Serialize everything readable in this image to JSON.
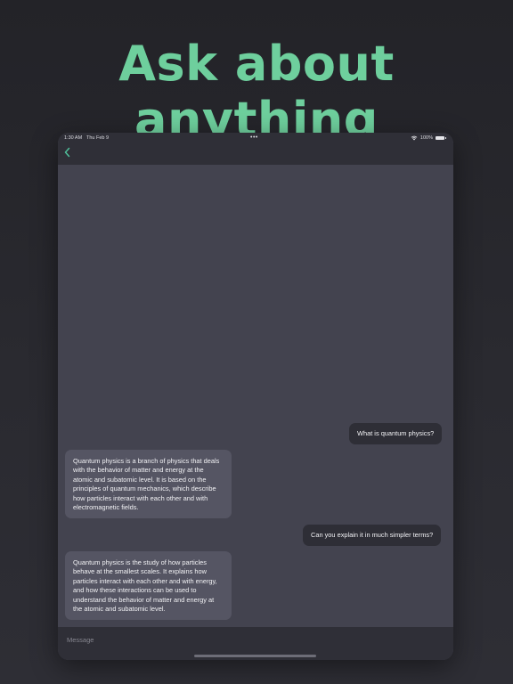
{
  "headline": "Ask about anything",
  "status_bar": {
    "time": "1:30 AM",
    "date": "Thu Feb 9",
    "dots": "•••",
    "battery": "100%",
    "wifi_icon": "wifi-icon",
    "battery_icon": "battery-icon"
  },
  "nav": {
    "back_icon": "chevron-left-icon"
  },
  "messages": [
    {
      "role": "user",
      "text": "What is quantum physics?"
    },
    {
      "role": "assistant",
      "text": "Quantum physics is a branch of physics that deals with the behavior of matter and energy at the atomic and subatomic level. It is based on the principles of quantum mechanics, which describe how particles interact with each other and with electromagnetic fields."
    },
    {
      "role": "user",
      "text": "Can you explain it in much simpler terms?"
    },
    {
      "role": "assistant",
      "text": "Quantum physics is the study of how particles behave at the smallest scales. It explains how particles interact with each other and with energy, and how these interactions can be used to understand the behavior of matter and energy at the atomic and subatomic level."
    }
  ],
  "composer": {
    "placeholder": "Message"
  },
  "colors": {
    "accent": "#6ecf9d",
    "back_chevron": "#4fbf9a",
    "chat_background": "#43434f",
    "user_bubble": "#2e2e36",
    "assistant_bubble": "#555563"
  }
}
